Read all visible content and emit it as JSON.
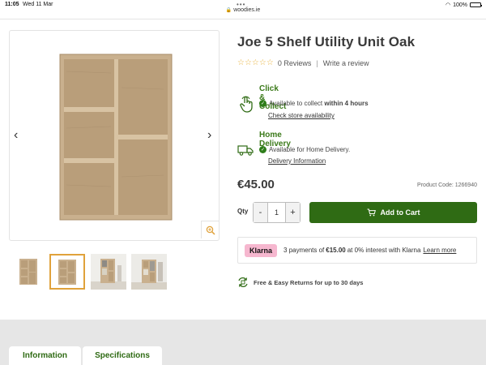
{
  "status_bar": {
    "time": "11:05",
    "date": "Wed 11 Mar",
    "battery": "100%"
  },
  "browser": {
    "url": "woodies.ie"
  },
  "gallery": {
    "thumbnails": [
      {
        "name": "thumb-front",
        "active": false
      },
      {
        "name": "thumb-front-selected",
        "active": true
      },
      {
        "name": "thumb-room-1",
        "active": false
      },
      {
        "name": "thumb-room-2",
        "active": false
      }
    ]
  },
  "product": {
    "title": "Joe 5 Shelf Utility Unit Oak",
    "reviews_count": "0 Reviews",
    "write_review": "Write a review",
    "price": "€45.00",
    "product_code": "Product Code: 1266940"
  },
  "click_collect": {
    "title": "Click & Collect",
    "line_prefix": "Available to collect ",
    "line_bold": "within 4 hours",
    "link": "Check store availability"
  },
  "home_delivery": {
    "title": "Home Delivery",
    "line": "Available for Home Delivery.",
    "link": "Delivery Information"
  },
  "purchase": {
    "qty_label": "Qty",
    "minus": "-",
    "qty_value": "1",
    "plus": "+",
    "add_to_cart": "Add to Cart"
  },
  "klarna": {
    "logo": "Klarna",
    "text_prefix": "3 payments of",
    "amount": "€15.00",
    "text_suffix": "at 0% interest with Klarna",
    "learn_more": "Learn more"
  },
  "returns": {
    "text": "Free & Easy Returns for up to 30 days"
  },
  "tabs": [
    {
      "label": "Information"
    },
    {
      "label": "Specifications"
    }
  ],
  "colors": {
    "brand_green": "#2f6b14",
    "title_green": "#3b7a1a",
    "klarna_pink": "#f6b7cf",
    "star": "#e8b33f",
    "oak": "#c9b08e"
  }
}
